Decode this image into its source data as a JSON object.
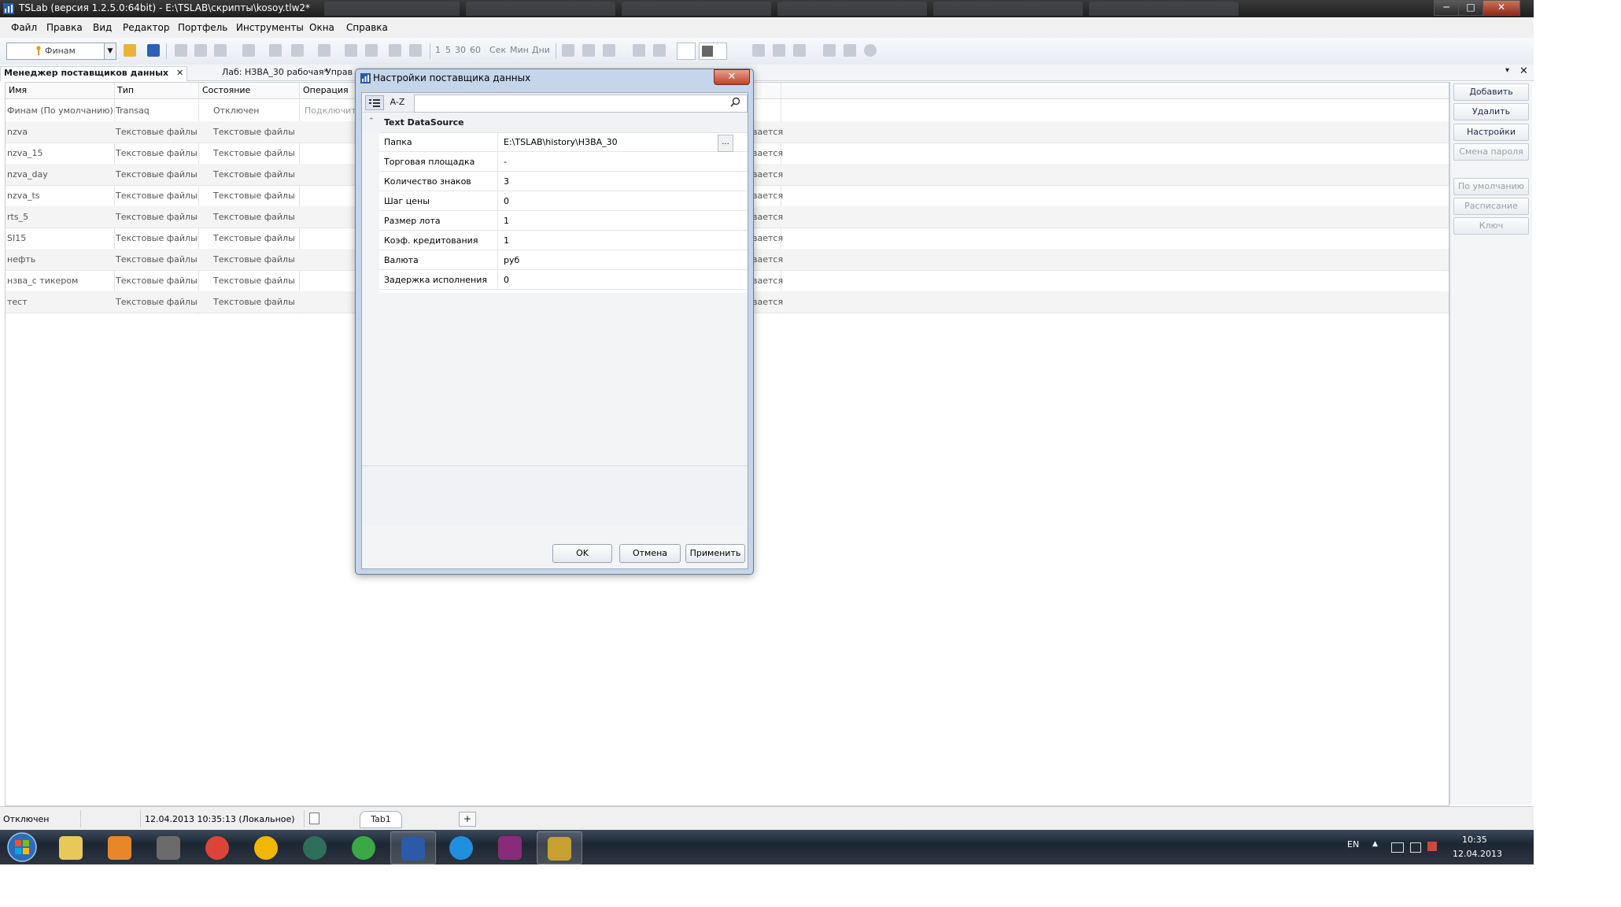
{
  "window": {
    "title": "TSLab (версия 1.2.5.0:64bit) - E:\\TSLAB\\скрипты\\kosoy.tlw2*",
    "controls": [
      "─",
      "□",
      "✕"
    ]
  },
  "menu": [
    "Файл",
    "Правка",
    "Вид",
    "Редактор",
    "Портфель",
    "Инструменты",
    "Окна",
    "Справка"
  ],
  "toolbar": {
    "portfolio": "Финам",
    "intervals": [
      "1",
      "5",
      "30",
      "60"
    ],
    "units": [
      "Сек",
      "Мин",
      "Дни"
    ]
  },
  "doc_tabs": {
    "active": "Менеджер поставщиков данных",
    "second": "Лаб: НЗВА_30 рабочая*",
    "third": "Управ"
  },
  "grid": {
    "columns": [
      "Имя",
      "Тип",
      "Состояние",
      "Операция"
    ],
    "rows": [
      {
        "name": "Финам (По умолчанию)",
        "type": "Transaq",
        "state": "Отключен",
        "op": "Подключит",
        "extra": ""
      },
      {
        "name": "nzva",
        "type": "Текстовые файлы",
        "state": "Текстовые файлы",
        "op": "",
        "extra": "вается"
      },
      {
        "name": "nzva_15",
        "type": "Текстовые файлы",
        "state": "Текстовые файлы",
        "op": "",
        "extra": "вается"
      },
      {
        "name": "nzva_day",
        "type": "Текстовые файлы",
        "state": "Текстовые файлы",
        "op": "",
        "extra": "вается"
      },
      {
        "name": "nzva_ts",
        "type": "Текстовые файлы",
        "state": "Текстовые файлы",
        "op": "",
        "extra": "вается"
      },
      {
        "name": "rts_5",
        "type": "Текстовые файлы",
        "state": "Текстовые файлы",
        "op": "",
        "extra": "вается"
      },
      {
        "name": "SI15",
        "type": "Текстовые файлы",
        "state": "Текстовые файлы",
        "op": "",
        "extra": "вается"
      },
      {
        "name": "нефть",
        "type": "Текстовые файлы",
        "state": "Текстовые файлы",
        "op": "",
        "extra": "вается"
      },
      {
        "name": "нзва_с тикером",
        "type": "Текстовые файлы",
        "state": "Текстовые файлы",
        "op": "",
        "extra": "вается"
      },
      {
        "name": "тест",
        "type": "Текстовые файлы",
        "state": "Текстовые файлы",
        "op": "",
        "extra": "вается"
      }
    ]
  },
  "right_panel": {
    "add": "Добавить",
    "delete": "Удалить",
    "settings": "Настройки",
    "change_password": "Смена пароля",
    "default": "По умолчанию",
    "schedule": "Расписание",
    "key": "Ключ"
  },
  "dialog": {
    "title": "Настройки поставщика данных",
    "sort_az": "A-Z",
    "search_value": "",
    "category": "Text DataSource",
    "properties": [
      {
        "name": "Папка",
        "value": "E:\\TSLAB\\history\\НЗВА_30"
      },
      {
        "name": "Торговая площадка",
        "value": "-"
      },
      {
        "name": "Количество знаков",
        "value": "3"
      },
      {
        "name": "Шаг цены",
        "value": "0"
      },
      {
        "name": "Размер лота",
        "value": "1"
      },
      {
        "name": "Коэф. кредитования",
        "value": "1"
      },
      {
        "name": "Валюта",
        "value": "руб"
      },
      {
        "name": "Задержка исполнения",
        "value": "0"
      }
    ],
    "browse": "...",
    "ok": "OK",
    "cancel": "Отмена",
    "apply": "Применить"
  },
  "status": {
    "connection": "Отключен",
    "datetime": "12.04.2013 10:35:13 (Локальное)",
    "tab": "Tab1",
    "add_tab": "+"
  },
  "tray": {
    "lang": "EN",
    "time": "10:35",
    "date": "12.04.2013"
  }
}
